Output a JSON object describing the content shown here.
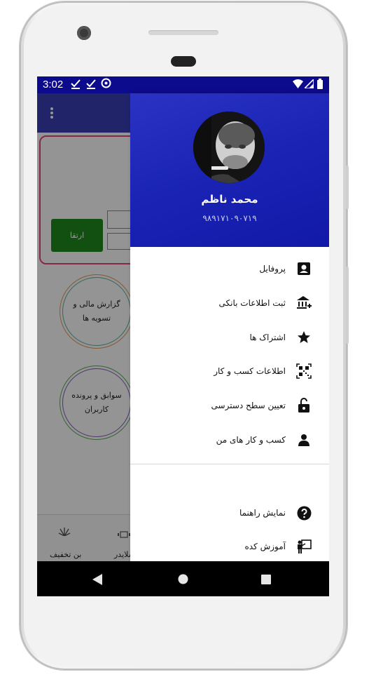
{
  "status_bar": {
    "time": "3:02",
    "icons": [
      "check-underline-icon",
      "check-underline-icon",
      "at-sync-icon",
      "wifi-icon",
      "signal-icon",
      "battery-icon"
    ]
  },
  "background_app": {
    "upgrade_label": "ارتقا",
    "circle_financial": "گزارش مالی و تسویه ها",
    "circle_records": "سوابق و پرونده کاربران",
    "bottom_tabs": [
      {
        "label": "بن تخفیف",
        "icon": "discount-icon"
      },
      {
        "label": "اسلایدر",
        "icon": "slider-icon"
      }
    ]
  },
  "drawer": {
    "user_name": "محمد ناظم",
    "user_phone": "۹۸۹۱۷۱۰۹۰۷۱۹",
    "menu": [
      {
        "label": "پروفایل",
        "icon": "account-box-icon"
      },
      {
        "label": "ثبت اطلاعات بانکی",
        "icon": "bank-plus-icon"
      },
      {
        "label": "اشتراک ها",
        "icon": "star-icon"
      },
      {
        "label": "اطلاعات کسب و کار",
        "icon": "qrcode-icon"
      },
      {
        "label": "تعیین سطح دسترسی",
        "icon": "lock-open-icon"
      },
      {
        "label": "کسب و کار های من",
        "icon": "person-icon"
      }
    ],
    "footer_menu": [
      {
        "label": "نمایش راهنما",
        "icon": "help-circle-icon"
      },
      {
        "label": "آموزش کده",
        "icon": "teacher-board-icon"
      }
    ]
  },
  "colors": {
    "status_bar": "#0d0b8d",
    "drawer_header": "#1a23b4",
    "upgrade_button": "#1f8a1f",
    "card_border": "#e5487b"
  }
}
